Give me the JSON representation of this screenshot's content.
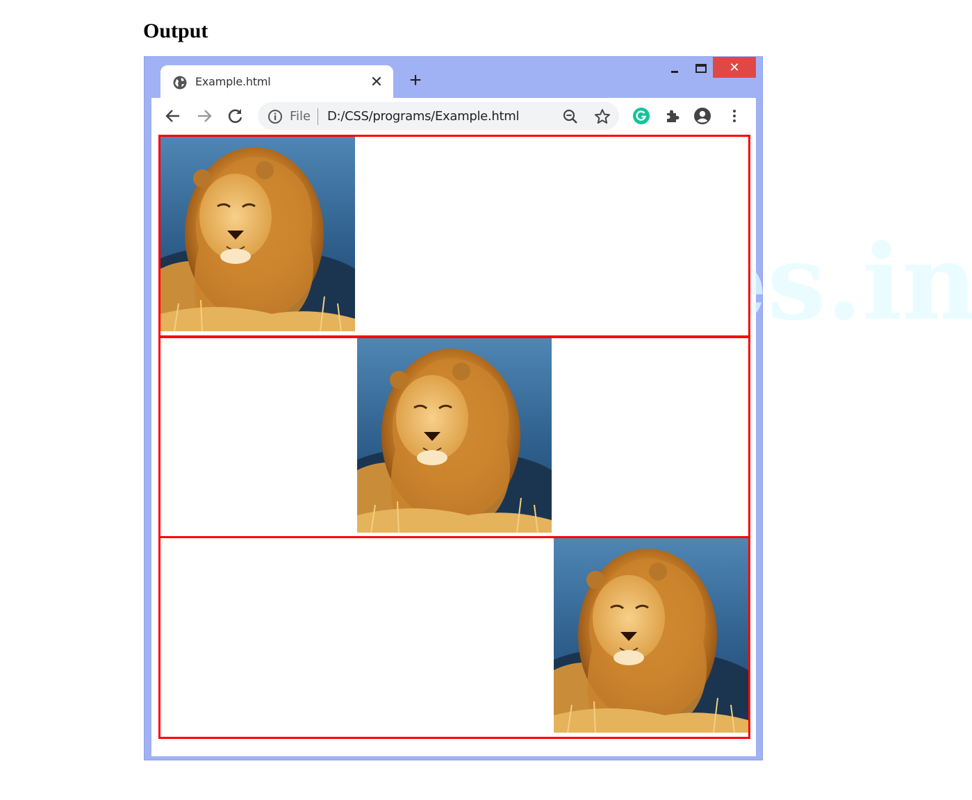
{
  "heading": "Output",
  "browser": {
    "tab_title": "Example.html",
    "tab_close": "✕",
    "new_tab": "+",
    "window_close": "✕",
    "address": {
      "scheme": "File",
      "url": "D:/CSS/programs/Example.html"
    }
  },
  "page": {
    "watermark": "tutnotes.in",
    "images": [
      {
        "alignment": "left",
        "alt": "lion"
      },
      {
        "alignment": "center",
        "alt": "lion"
      },
      {
        "alignment": "right",
        "alt": "lion"
      }
    ]
  },
  "colors": {
    "chrome_frame": "#a0b2f3",
    "border_red": "#ff0000",
    "close_red": "#e04848",
    "grammarly_green": "#15c39a"
  }
}
